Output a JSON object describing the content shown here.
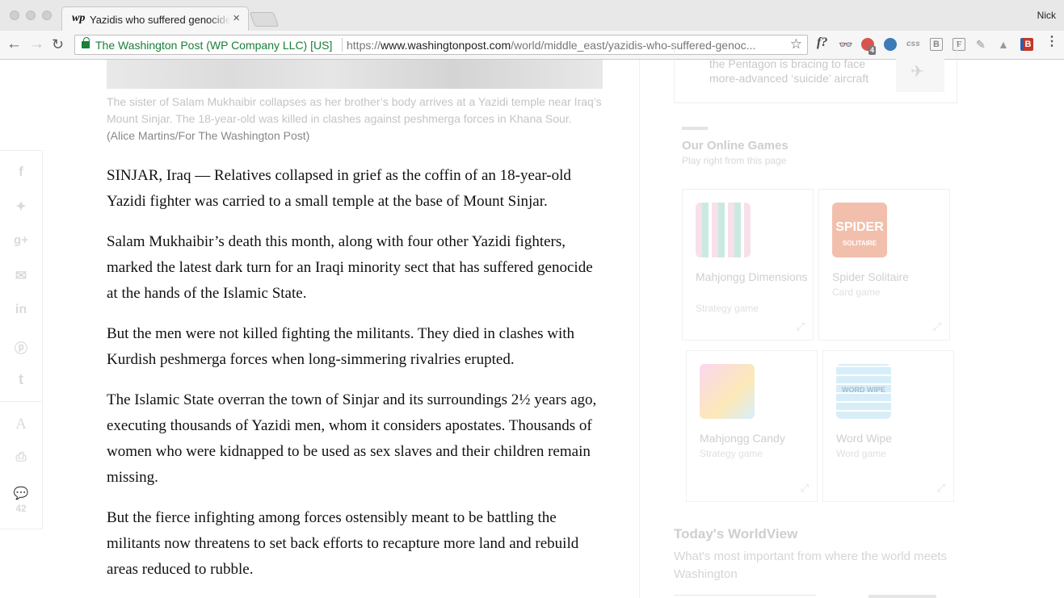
{
  "browser": {
    "tab_title": "Yazidis who suffered genocide at the hands of ISIS are now fighting Kurds",
    "tab_favicon": "wp",
    "profile_name": "Nick",
    "cert_label": "The Washington Post (WP Company LLC) [US]",
    "url_scheme": "https://",
    "url_host": "www.washingtonpost.com",
    "url_path": "/world/middle_east/yazidis-who-suffered-genoc...",
    "extensions": [
      "f?",
      "css",
      "B",
      "F",
      "B"
    ],
    "ext_badge": "4"
  },
  "article": {
    "caption_main": "The sister of Salam Mukhaibir collapses as her brother’s body arrives at a Yazidi temple near Iraq’s Mount Sinjar. The 18-year-old was killed in clashes against peshmerga forces in Khana Sour.",
    "caption_credit": "(Alice Martins/For The Washington Post)",
    "paragraphs": [
      "SINJAR, Iraq — Relatives collapsed in grief as the coffin of an 18-year-old Yazidi fighter was carried to a small temple at the base of Mount Sinjar.",
      "Salam Mukhaibir’s death this month, along with four other Yazidi fighters, marked the latest dark turn for an Iraqi minority sect that has suffered genocide at the hands of the Islamic State.",
      "But the men were not killed fighting the militants. They died in clashes with Kurdish peshmerga forces when long-simmering rivalries erupted.",
      "The Islamic State overran the town of Sinjar and its surroundings 2½ years ago, executing thousands of Yazidi men, whom it considers apostates. Thousands of women who were kidnapped to be used as sex slaves and their children remain missing.",
      "But the fierce infighting among forces ostensibly meant to be battling the militants now threatens to set back efforts to recapture more land and rebuild areas reduced to rubble."
    ]
  },
  "share": {
    "comment_count": "42",
    "icons": [
      "facebook-icon",
      "twitter-icon",
      "google-plus-icon",
      "email-icon",
      "linkedin-icon",
      "pinterest-icon",
      "tumblr-icon",
      "font-size-icon",
      "print-icon",
      "comments-icon"
    ]
  },
  "sidebar": {
    "promo_text": "the Pentagon is bracing to face more-advanced ‘suicide’ aircraft",
    "games_title": "Our Online Games",
    "games_sub": "Play right from this page",
    "games": [
      {
        "name": "Mahjongg Dimensions",
        "type": "Strategy game"
      },
      {
        "name": "Spider Solitaire",
        "type": "Card game"
      },
      {
        "name": "Mahjongg Candy",
        "type": "Strategy game"
      },
      {
        "name": "Word Wipe",
        "type": "Word game"
      }
    ],
    "game_thumb_labels": [
      "SPIDER",
      "SOLITAIRE",
      "WORD WIPE"
    ],
    "worldview_title": "Today's WorldView",
    "worldview_desc": "What's most important from where the world meets Washington"
  }
}
